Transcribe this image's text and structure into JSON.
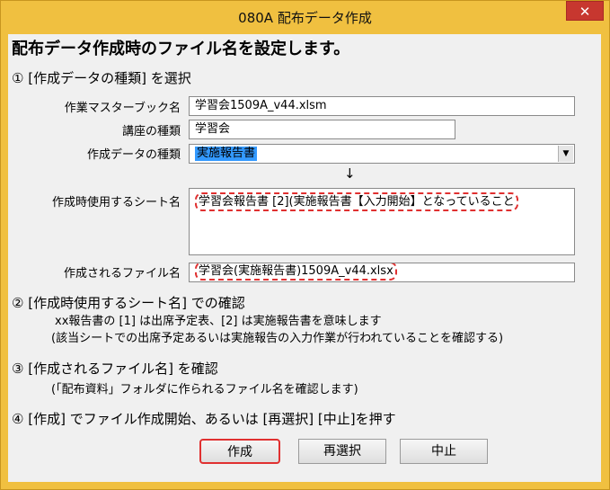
{
  "window": {
    "title": "080A 配布データ作成",
    "close_label": "✕"
  },
  "heading": "配布データ作成時のファイル名を設定します。",
  "step1": {
    "title": "① [作成データの種類] を選択",
    "workbook_label": "作業マスターブック名",
    "workbook_value": "学習会1509A_v44.xlsm",
    "course_label": "講座の種類",
    "course_value": "学習会",
    "datatype_label": "作成データの種類",
    "datatype_value": "実施報告書",
    "arrow": "↓",
    "sheet_label": "作成時使用するシート名",
    "sheet_value": "学習会報告書 [2](実施報告書【入力開始】となっていること",
    "filename_label": "作成されるファイル名",
    "filename_value": "学習会(実施報告書)1509A_v44.xlsx"
  },
  "step2": {
    "title": "② [作成時使用するシート名] での確認",
    "line1": "xx報告書の [1] は出席予定表、[2] は実施報告書を意味します",
    "line2": "(該当シートでの出席予定あるいは実施報告の入力作業が行われていることを確認する)"
  },
  "step3": {
    "title": "③ [作成されるファイル名] を確認",
    "line1": "(「配布資料」フォルダに作られるファイル名を確認します)"
  },
  "step4": {
    "title": "④ [作成] でファイル作成開始、あるいは [再選択] [中止]を押す"
  },
  "buttons": {
    "create": "作成",
    "reselect": "再選択",
    "cancel": "中止"
  },
  "colors": {
    "frame": "#f0c040",
    "close": "#c7372f",
    "highlight": "#e03030",
    "selection": "#3399ff"
  }
}
